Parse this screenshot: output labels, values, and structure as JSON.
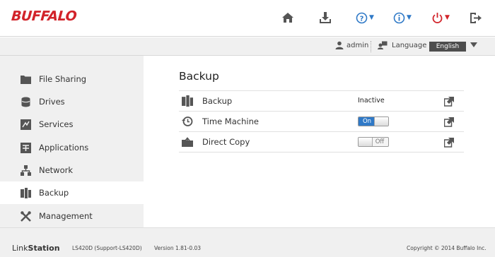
{
  "header": {
    "logo": "BUFFALO",
    "icons": [
      "home-icon",
      "download-icon",
      "help-icon",
      "info-icon",
      "power-icon",
      "logout-icon"
    ],
    "caret": "▼"
  },
  "subbar": {
    "user": "admin",
    "language_label": "Language",
    "language_value": "English"
  },
  "sidebar": {
    "items": [
      {
        "label": "File Sharing",
        "icon": "folder-icon"
      },
      {
        "label": "Drives",
        "icon": "drive-icon"
      },
      {
        "label": "Services",
        "icon": "services-icon"
      },
      {
        "label": "Applications",
        "icon": "applications-icon"
      },
      {
        "label": "Network",
        "icon": "network-icon"
      },
      {
        "label": "Backup",
        "icon": "backup-icon",
        "active": true
      },
      {
        "label": "Management",
        "icon": "management-icon"
      }
    ]
  },
  "main": {
    "title": "Backup",
    "rows": [
      {
        "name": "Backup",
        "status": "Inactive",
        "icon": "backup-icon"
      },
      {
        "name": "Time Machine",
        "toggle": "On",
        "icon": "time-machine-icon"
      },
      {
        "name": "Direct Copy",
        "toggle": "Off",
        "icon": "direct-copy-icon"
      }
    ]
  },
  "footer": {
    "brand_a": "Link",
    "brand_b": "Station",
    "model": "LS420D (Support-LS420D)",
    "version": "Version 1.81-0.03",
    "copyright": "Copyright © 2014 Buffalo Inc."
  },
  "colors": {
    "brand_red": "#d2232a",
    "help_blue": "#2f79c7",
    "toggle_on": "#2f79c7",
    "sidebar_bg": "#f0f0f0"
  }
}
